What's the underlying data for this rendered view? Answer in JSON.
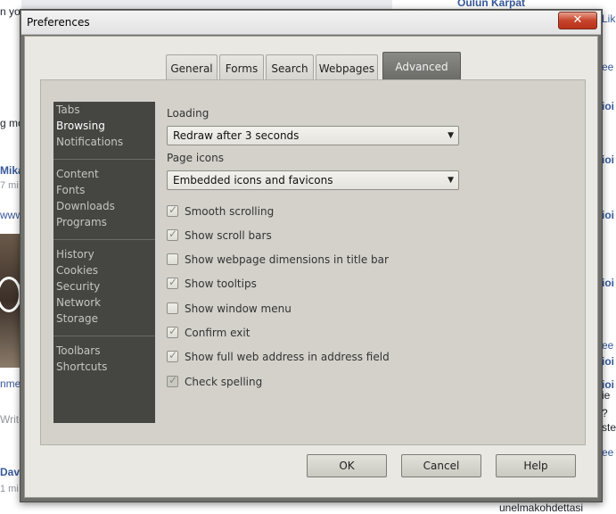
{
  "background": {
    "top_right_name": "Oulun Karpat",
    "left_fragments": [
      "n yo",
      "g mo",
      "Mika",
      "7 mi",
      "www.",
      "nme",
      "Write",
      "Davi",
      "1 mi"
    ],
    "right_fragments": [
      "Lik",
      "ee",
      "ioi",
      "ioi",
      "ioi",
      "ioi",
      "ee",
      "ioi",
      "ioi",
      "ee",
      "ie",
      "?",
      "ste"
    ],
    "bottom_text": "unelmakohdettasi"
  },
  "dialog": {
    "title": "Preferences",
    "close_label": "✕",
    "tabs": [
      "General",
      "Forms",
      "Search",
      "Webpages",
      "Advanced"
    ],
    "active_tab": "Advanced",
    "sidebar": {
      "groups": [
        [
          "Tabs",
          "Browsing",
          "Notifications"
        ],
        [
          "Content",
          "Fonts",
          "Downloads",
          "Programs"
        ],
        [
          "History",
          "Cookies",
          "Security",
          "Network",
          "Storage"
        ],
        [
          "Toolbars",
          "Shortcuts"
        ]
      ],
      "selected": "Browsing"
    },
    "loading": {
      "label": "Loading",
      "value": "Redraw after 3 seconds"
    },
    "page_icons": {
      "label": "Page icons",
      "value": "Embedded icons and favicons"
    },
    "options": [
      {
        "label": "Smooth scrolling",
        "checked": true
      },
      {
        "label": "Show scroll bars",
        "checked": true
      },
      {
        "label": "Show webpage dimensions in title bar",
        "checked": false
      },
      {
        "label": "Show tooltips",
        "checked": true
      },
      {
        "label": "Show window menu",
        "checked": false
      },
      {
        "label": "Confirm exit",
        "checked": true
      },
      {
        "label": "Show full web address in address field",
        "checked": true
      },
      {
        "label": "Check spelling",
        "checked": true
      }
    ],
    "buttons": {
      "ok": "OK",
      "cancel": "Cancel",
      "help": "Help"
    }
  },
  "colors": {
    "accent_tab": "#6c6c68",
    "sidebar_bg": "#454542",
    "close_button": "#c7432b"
  }
}
